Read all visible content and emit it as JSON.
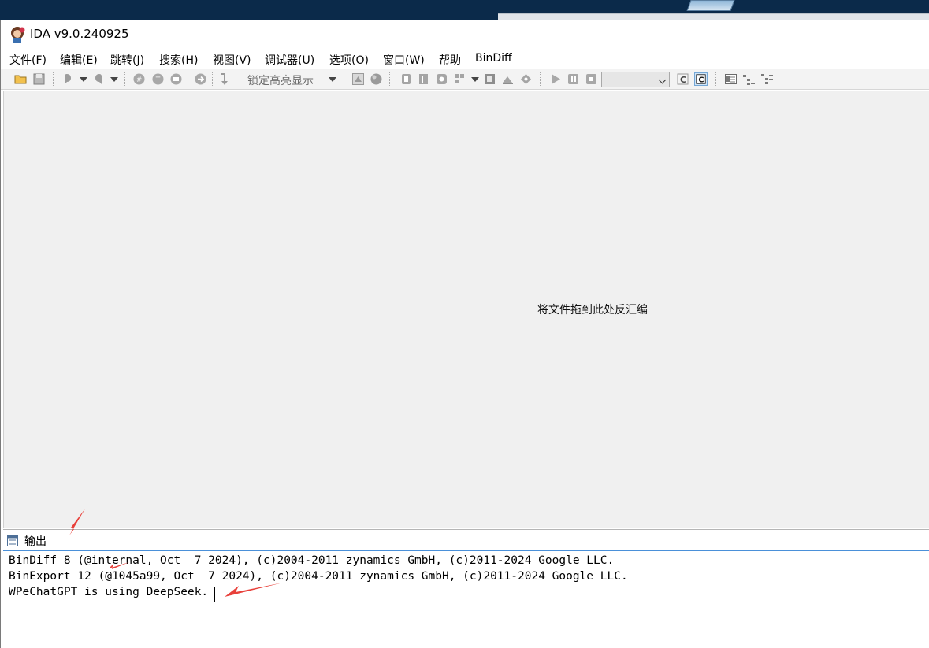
{
  "window": {
    "title": "IDA v9.0.240925"
  },
  "menu": [
    {
      "label": "文件(F)"
    },
    {
      "label": "编辑(E)"
    },
    {
      "label": "跳转(J)"
    },
    {
      "label": "搜索(H)"
    },
    {
      "label": "视图(V)"
    },
    {
      "label": "调试器(U)"
    },
    {
      "label": "选项(O)"
    },
    {
      "label": "窗口(W)"
    },
    {
      "label": "帮助"
    },
    {
      "label": "BinDiff"
    }
  ],
  "toolbar": {
    "lock_highlight_label": "锁定高亮显示",
    "debugger_combo_value": ""
  },
  "workspace": {
    "drop_hint": "将文件拖到此处反汇编"
  },
  "output": {
    "title": "输出",
    "lines": [
      "BinDiff 8 (@internal, Oct  7 2024), (c)2004-2011 zynamics GmbH, (c)2011-2024 Google LLC.",
      "BinExport 12 (@1045a99, Oct  7 2024), (c)2004-2011 zynamics GmbH, (c)2011-2024 Google LLC.",
      "WPeChatGPT is using DeepSeek."
    ]
  },
  "colors": {
    "annotation_arrow": "#e8403a",
    "workspace_bg": "#f0f0f0",
    "toolbar_bg": "#f3f3f3",
    "desktop_bg": "#0b2a4a"
  }
}
